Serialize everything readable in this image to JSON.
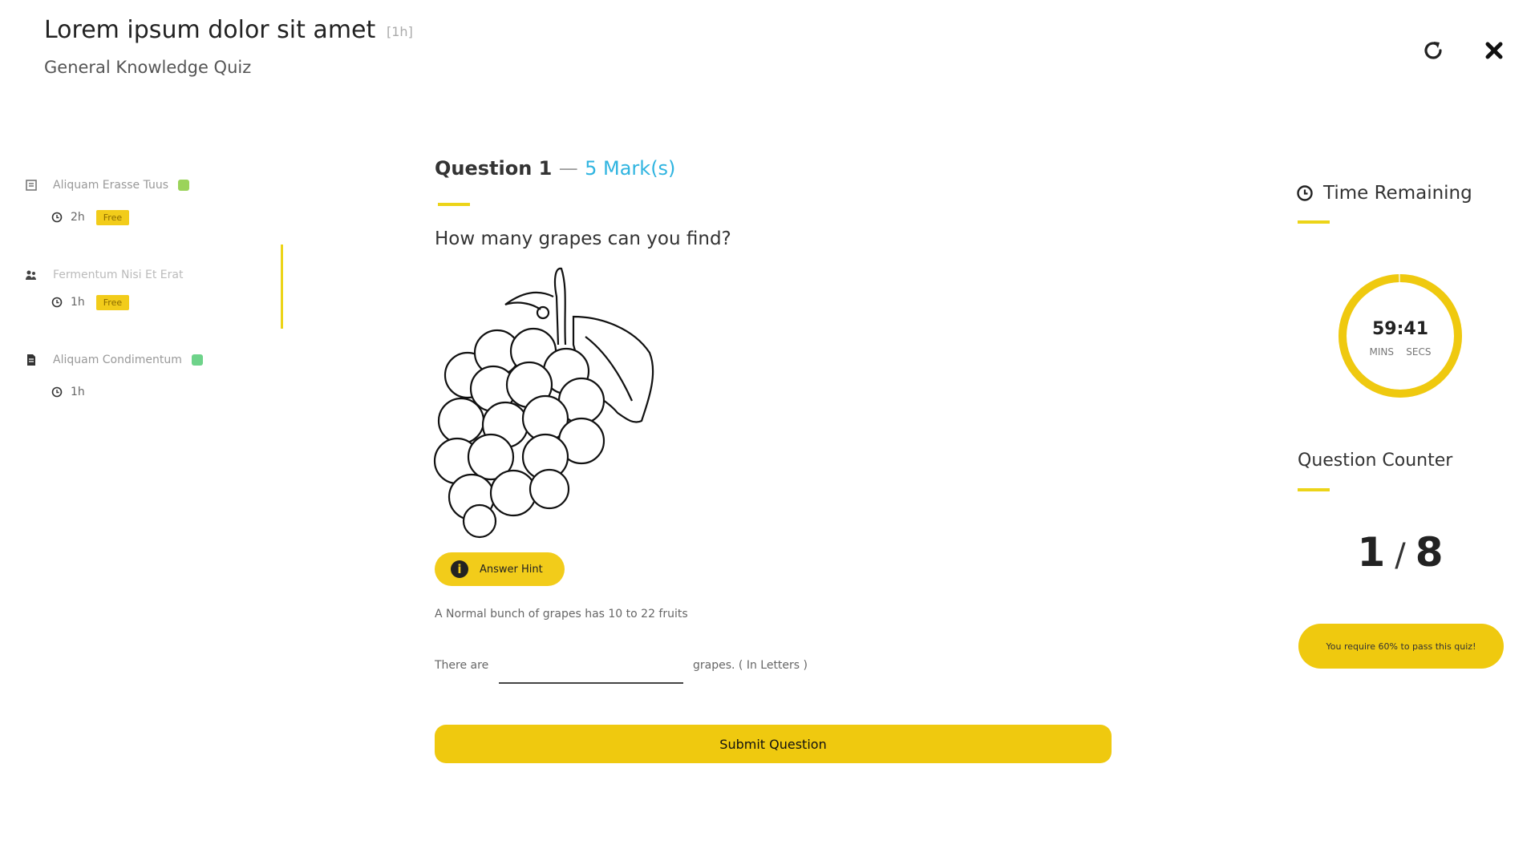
{
  "header": {
    "title": "Lorem ipsum dolor sit amet",
    "title_badge": "[1h]",
    "subtitle": "General Knowledge Quiz"
  },
  "sidebar": {
    "items": [
      {
        "label": "Aliquam Erasse Tuus",
        "duration": "2h",
        "badge": "Free",
        "icon": "lesson-icon",
        "status": "check-icon",
        "status_color": "#9bd35a"
      },
      {
        "label": "Fermentum Nisi Et Erat",
        "duration": "1h",
        "badge": "Free",
        "icon": "people-icon",
        "status": "",
        "status_color": ""
      },
      {
        "label": "Aliquam Condimentum",
        "duration": "1h",
        "badge": "",
        "icon": "document-icon",
        "status": "check-icon",
        "status_color": "#6ed38a"
      }
    ]
  },
  "question": {
    "heading": "Question 1",
    "dash": "—",
    "marks": "5 Mark(s)",
    "text": "How many grapes can you find?",
    "hint_label": "Answer Hint",
    "hint_text": "A Normal bunch of grapes has 10 to 22 fruits",
    "fill_pre": "There are",
    "fill_post": "grapes. ( In Letters )",
    "input_value": "",
    "submit_label": "Submit Question"
  },
  "timer": {
    "title": "Time Remaining",
    "time": "59:41",
    "units": "MINS    SECS",
    "progress": 0.995
  },
  "counter": {
    "title": "Question Counter",
    "current": "1",
    "separator": "/",
    "total": "8",
    "pass_note": "You require 60% to pass this quiz!"
  },
  "colors": {
    "accent": "#efc90f",
    "marks": "#2fb4e0"
  }
}
